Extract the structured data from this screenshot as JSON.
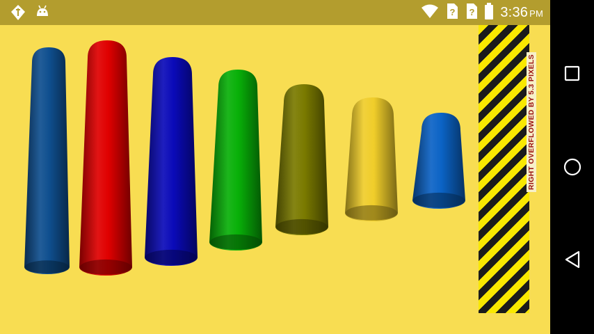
{
  "status_bar": {
    "time": "3:36",
    "ampm": "PM",
    "left_icons": [
      "no-sim-notification-icon",
      "android-debug-icon"
    ],
    "right_icons": [
      "wifi-icon",
      "sim-unknown-icon",
      "sim-unknown-icon",
      "battery-icon"
    ]
  },
  "app": {
    "background_color": "#f8dd52",
    "cylinders": [
      {
        "name": "cylinder-steel-blue",
        "color": "#0f4f8f"
      },
      {
        "name": "cylinder-red",
        "color": "#e00000"
      },
      {
        "name": "cylinder-blue",
        "color": "#0a0ab8"
      },
      {
        "name": "cylinder-green",
        "color": "#08b008"
      },
      {
        "name": "cylinder-olive",
        "color": "#7a7a00"
      },
      {
        "name": "cylinder-yellow",
        "color": "#f0cd2a"
      },
      {
        "name": "cylinder-light-blue",
        "color": "#0b63c5"
      }
    ],
    "overflow_warning": "RIGHT OVERFLOWED BY 5.3 PIXELS"
  },
  "nav_bar": {
    "buttons": [
      "recents-square-icon",
      "home-circle-icon",
      "back-triangle-icon"
    ]
  }
}
